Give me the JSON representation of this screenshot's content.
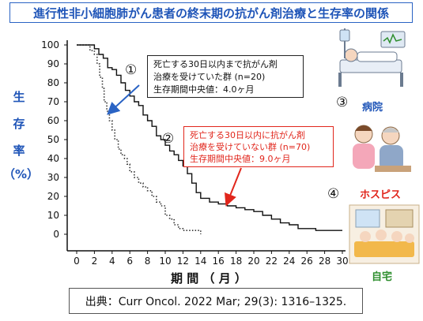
{
  "title": "進行性非小細胞肺がん患者の終末期の抗がん剤治療と生存率の関係",
  "y_axis_chars": [
    "生",
    "存",
    "率",
    "（%）"
  ],
  "x_axis_label": "期 間 （ 月 ）",
  "group1": {
    "marker": "①",
    "line1": "死亡する30日以内まで抗がん剤",
    "line2": "治療を受けていた群 (n=20)",
    "line3": "生存期間中央値：4.0ヶ月"
  },
  "group2": {
    "marker": "②",
    "line1": "死亡する30日以内に抗がん剤",
    "line2": "治療を受けていない群 (n=70)",
    "line3": "生存期間中央値：9.0ヶ月"
  },
  "places": [
    {
      "marker": "③",
      "label": "病院",
      "color": "#1f55b8"
    },
    {
      "marker": "",
      "label": "ホスピス",
      "color": "#e1261c"
    },
    {
      "marker": "④",
      "label": "自宅",
      "color": "#2f8f2f"
    }
  ],
  "source": "出典：Curr Oncol. 2022 Mar; 29(3): 1316–1325.",
  "chart_data": {
    "type": "line",
    "title": "進行性非小細胞肺がん患者の終末期の抗がん剤治療と生存率の関係",
    "xlabel": "期 間 （ 月 ）",
    "ylabel": "生 存 率 （%）",
    "xlim": [
      0,
      30
    ],
    "ylim": [
      0,
      100
    ],
    "x_ticks": [
      0,
      2,
      4,
      6,
      8,
      10,
      12,
      14,
      16,
      18,
      20,
      22,
      24,
      26,
      28,
      30
    ],
    "y_ticks": [
      0,
      10,
      20,
      30,
      40,
      50,
      60,
      70,
      80,
      90,
      100
    ],
    "grid": false,
    "series": [
      {
        "name": "死亡する30日以内まで抗がん剤治療を受けていた群 (n=20)",
        "style": "dotted",
        "color": "#333333",
        "points": [
          [
            0,
            100
          ],
          [
            1.2,
            100
          ],
          [
            1.5,
            97
          ],
          [
            2,
            95
          ],
          [
            2.3,
            90
          ],
          [
            2.6,
            83
          ],
          [
            2.9,
            77
          ],
          [
            3.1,
            70
          ],
          [
            3.4,
            65
          ],
          [
            3.7,
            60
          ],
          [
            4,
            55
          ],
          [
            4.3,
            50
          ],
          [
            4.7,
            45
          ],
          [
            5,
            42
          ],
          [
            5.4,
            40
          ],
          [
            5.7,
            37
          ],
          [
            6,
            33
          ],
          [
            6.5,
            30
          ],
          [
            7,
            27
          ],
          [
            7.5,
            25
          ],
          [
            8,
            23
          ],
          [
            8.5,
            20
          ],
          [
            9,
            17
          ],
          [
            9.5,
            15
          ],
          [
            10,
            10
          ],
          [
            10.5,
            8
          ],
          [
            11,
            5
          ],
          [
            11.5,
            3
          ],
          [
            12,
            2
          ],
          [
            13,
            2
          ],
          [
            14,
            0
          ]
        ]
      },
      {
        "name": "死亡する30日以内に抗がん剤治療を受けていない群 (n=70)",
        "style": "solid",
        "color": "#111111",
        "points": [
          [
            0,
            100
          ],
          [
            1.5,
            100
          ],
          [
            2,
            98
          ],
          [
            2.5,
            95
          ],
          [
            3,
            93
          ],
          [
            3.5,
            88
          ],
          [
            4,
            87
          ],
          [
            4.5,
            84
          ],
          [
            5,
            80
          ],
          [
            5.5,
            76
          ],
          [
            6,
            73
          ],
          [
            6.5,
            70
          ],
          [
            7,
            68
          ],
          [
            7.5,
            63
          ],
          [
            8,
            60
          ],
          [
            8.5,
            57
          ],
          [
            9,
            52
          ],
          [
            9.5,
            50
          ],
          [
            10,
            47
          ],
          [
            10.5,
            44
          ],
          [
            11,
            42
          ],
          [
            11.5,
            39
          ],
          [
            12,
            36
          ],
          [
            12.5,
            32
          ],
          [
            13,
            27
          ],
          [
            13.5,
            22
          ],
          [
            14,
            19
          ],
          [
            15,
            17
          ],
          [
            16,
            16
          ],
          [
            17,
            15
          ],
          [
            18,
            14
          ],
          [
            19,
            13
          ],
          [
            20,
            12
          ],
          [
            21,
            10
          ],
          [
            22,
            8
          ],
          [
            23,
            6
          ],
          [
            24,
            5
          ],
          [
            25,
            3
          ],
          [
            26,
            3
          ],
          [
            27,
            2
          ],
          [
            28,
            2
          ],
          [
            30,
            2
          ]
        ]
      }
    ]
  }
}
